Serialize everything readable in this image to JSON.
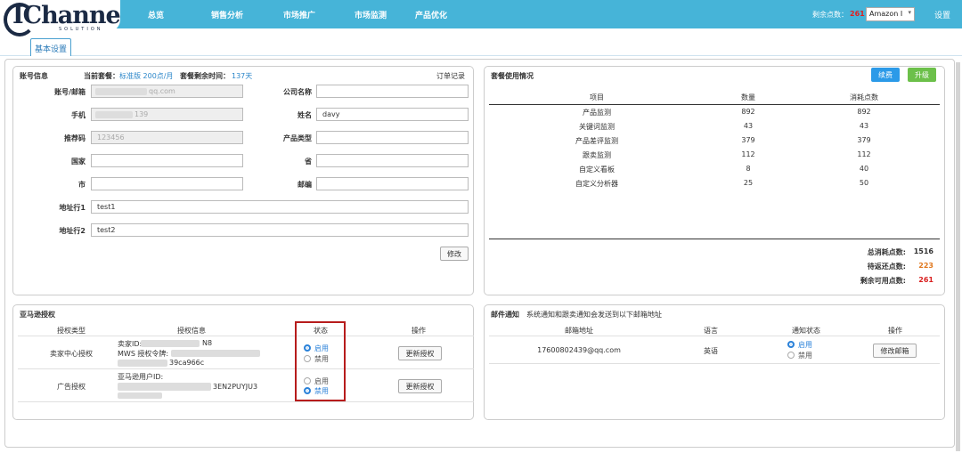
{
  "header": {
    "logo_text": "IChannel",
    "logo_sub": "SOLUTION",
    "nav": [
      "总览",
      "销售分析",
      "市场推广",
      "市场监测",
      "产品优化"
    ],
    "points_label": "剩余点数：",
    "points_value": "261",
    "store_select": "Amazon I",
    "settings": "设置"
  },
  "tab": {
    "label": "基本设置"
  },
  "account": {
    "title": "账号信息",
    "plan_label": "当前套餐：",
    "plan_value": "标准版 200点/月",
    "remain_label": "套餐剩余时间：",
    "remain_value": "137天",
    "order_link": "订单记录",
    "fields": {
      "email": {
        "label": "账号/邮箱",
        "value": "qq.com"
      },
      "company": {
        "label": "公司名称",
        "value": ""
      },
      "phone": {
        "label": "手机",
        "value": "139"
      },
      "name": {
        "label": "姓名",
        "value": "davy"
      },
      "referral": {
        "label": "推荐码",
        "value": "123456"
      },
      "product_type": {
        "label": "产品类型",
        "value": ""
      },
      "country": {
        "label": "国家",
        "value": ""
      },
      "province": {
        "label": "省",
        "value": ""
      },
      "city": {
        "label": "市",
        "value": ""
      },
      "postcode": {
        "label": "邮编",
        "value": ""
      },
      "addr1": {
        "label": "地址行1",
        "value": "test1"
      },
      "addr2": {
        "label": "地址行2",
        "value": "test2"
      }
    },
    "modify_button": "修改"
  },
  "usage": {
    "title": "套餐使用情况",
    "renew_button": "续费",
    "upgrade_button": "升级",
    "headers": [
      "项目",
      "数量",
      "消耗点数"
    ],
    "rows": [
      [
        "产品监测",
        "892",
        "892"
      ],
      [
        "关键词监测",
        "43",
        "43"
      ],
      [
        "产品差评监测",
        "379",
        "379"
      ],
      [
        "跟卖监测",
        "112",
        "112"
      ],
      [
        "自定义看板",
        "8",
        "40"
      ],
      [
        "自定义分析器",
        "25",
        "50"
      ]
    ],
    "total_label": "总消耗点数:",
    "total_value": "1516",
    "pending_label": "待返还点数:",
    "pending_value": "223",
    "avail_label": "剩余可用点数:",
    "avail_value": "261",
    "colors": {
      "pending": "#e0781e",
      "avail": "#d91e1e"
    }
  },
  "amazon": {
    "title": "亚马逊授权",
    "headers": [
      "授权类型",
      "授权信息",
      "状态",
      "操作"
    ],
    "rows": [
      {
        "type": "卖家中心授权",
        "info": [
          "卖家ID:",
          "N8",
          "MWS 授权令牌:",
          "39ca966c"
        ],
        "enable": "启用",
        "disable": "禁用",
        "state": "enabled",
        "action": "更新授权"
      },
      {
        "type": "广告授权",
        "info": [
          "亚马逊用户ID:",
          "3EN2PUYJU3"
        ],
        "enable": "启用",
        "disable": "禁用",
        "state": "disabled",
        "action": "更新授权"
      }
    ]
  },
  "email": {
    "title": "邮件通知",
    "desc": "系统通知和跟卖通知会发送到以下邮箱地址",
    "headers": [
      "邮箱地址",
      "语言",
      "通知状态",
      "操作"
    ],
    "row": {
      "address": "17600802439@qq.com",
      "lang": "英语",
      "enable": "启用",
      "disable": "禁用",
      "action": "修改邮箱"
    }
  }
}
